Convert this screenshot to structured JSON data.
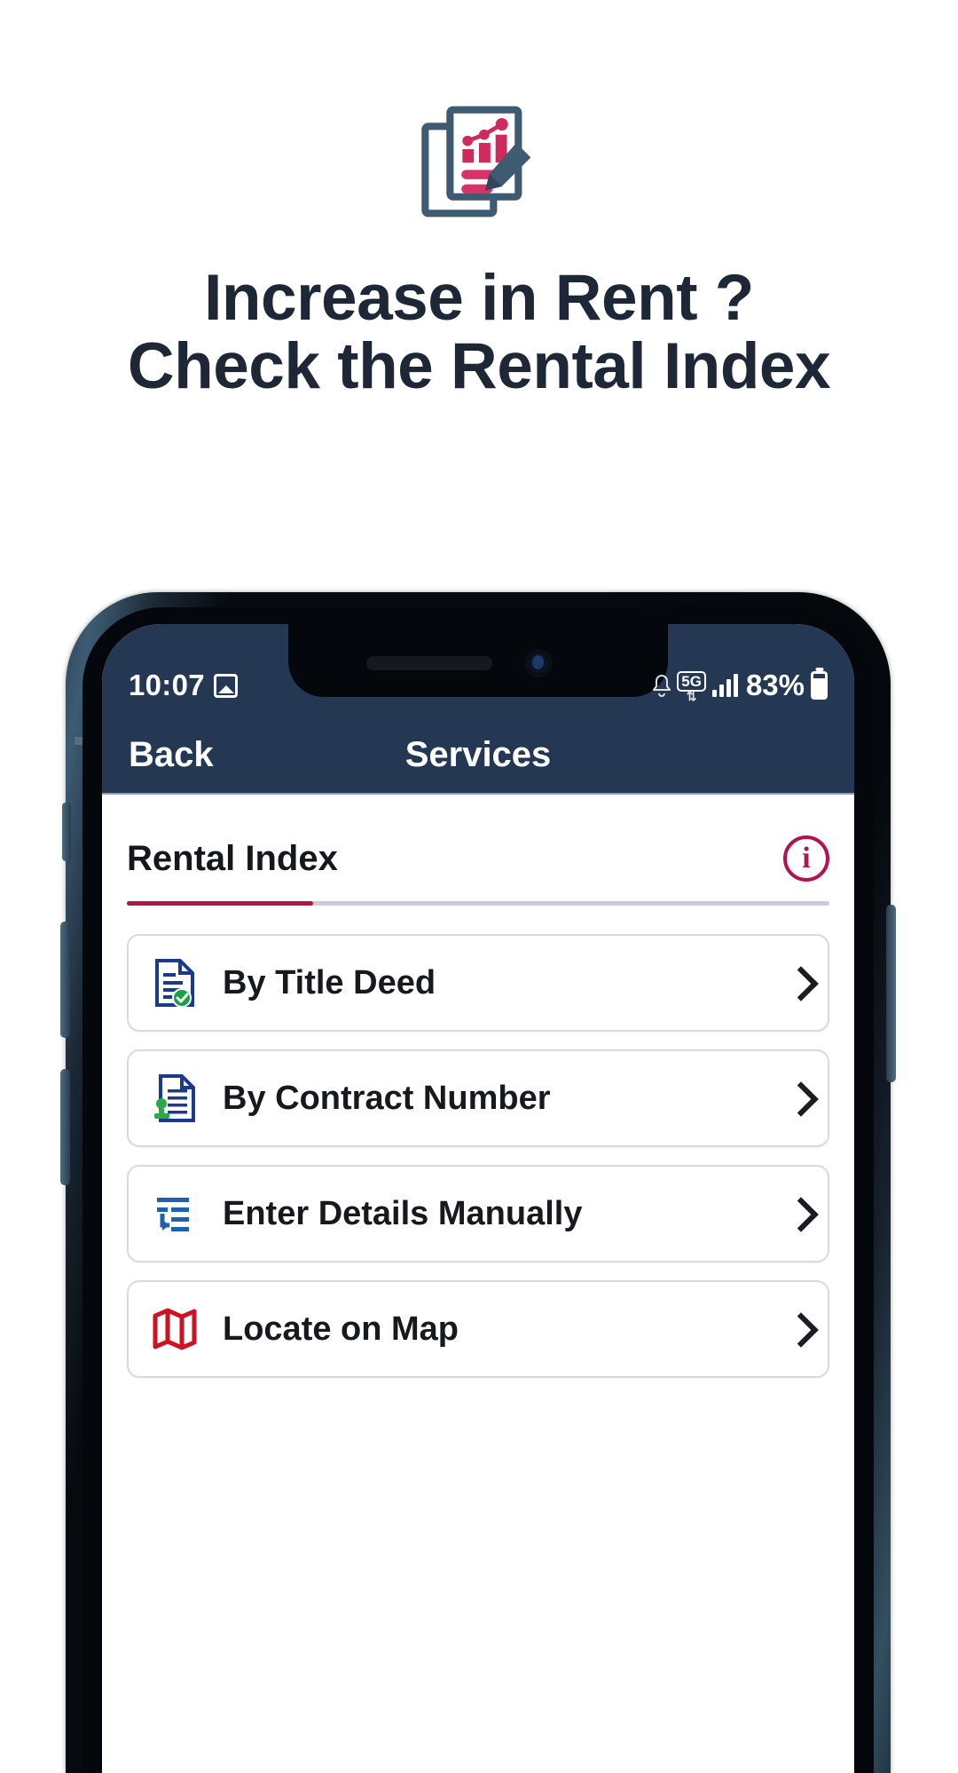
{
  "promo": {
    "icon": "report-chart-document-pencil-icon",
    "headline_line1": "Increase in Rent ?",
    "headline_line2": "Check the Rental Index",
    "headline_color": "#1d2735"
  },
  "phone": {
    "status_bar": {
      "time": "10:07",
      "image_icon": "image-icon",
      "secondary_icon": "alarm-icon",
      "network_badge": "5G",
      "network_arrows": "⇅",
      "signal_icon": "signal-bars-icon",
      "battery_percent": "83%",
      "battery_icon": "battery-icon"
    },
    "nav_bar": {
      "back_label": "Back",
      "title": "Services",
      "background": "#243753"
    },
    "content": {
      "tab": {
        "label": "Rental Index",
        "active": true,
        "accent_color": "#b4144b",
        "info_icon": "info-circle-icon",
        "info_glyph": "i"
      },
      "options": [
        {
          "label": "By Title Deed",
          "icon": "document-check-icon",
          "icon_color": "#1b3a8c",
          "badge_color": "#18a145",
          "chevron": "chevron-right-icon"
        },
        {
          "label": "By Contract Number",
          "icon": "document-stamp-icon",
          "icon_color": "#1b3a8c",
          "badge_color": "#2aa94a",
          "chevron": "chevron-right-icon"
        },
        {
          "label": "Enter Details Manually",
          "icon": "form-list-entry-icon",
          "icon_color": "#1d62b0",
          "badge_color": "#1d62b0",
          "chevron": "chevron-right-icon"
        },
        {
          "label": "Locate on Map",
          "icon": "folded-map-icon",
          "icon_color": "#cf1222",
          "badge_color": "#cf1222",
          "chevron": "chevron-right-icon"
        }
      ]
    }
  }
}
